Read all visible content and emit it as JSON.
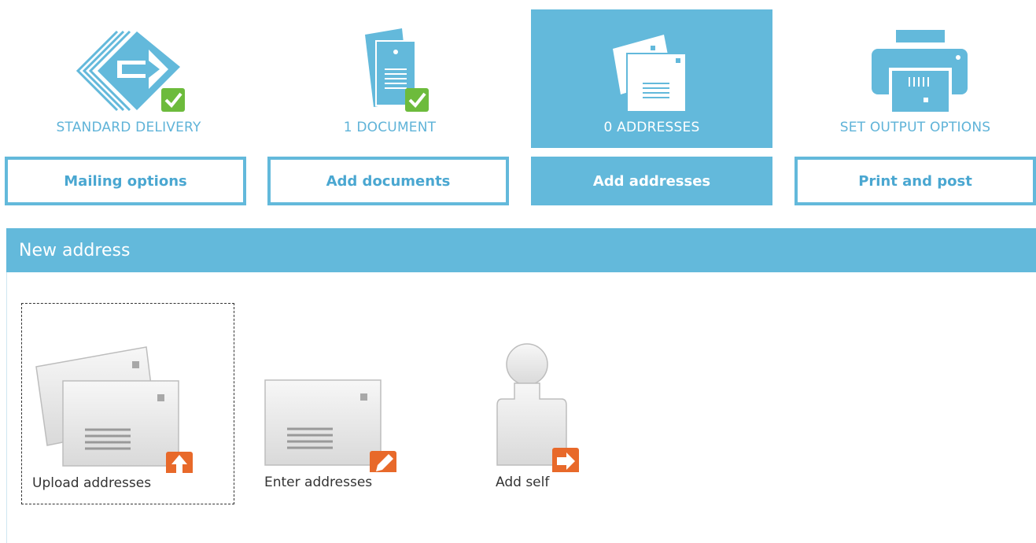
{
  "steps": [
    {
      "status": "STANDARD DELIVERY",
      "button_label": "Mailing options",
      "icon": "delivery-arrow-icon",
      "complete": true
    },
    {
      "status": "1 DOCUMENT",
      "button_label": "Add documents",
      "icon": "document-icon",
      "complete": true
    },
    {
      "status": "0 ADDRESSES",
      "button_label": "Add addresses",
      "icon": "envelopes-icon",
      "active": true
    },
    {
      "status": "SET OUTPUT OPTIONS",
      "button_label": "Print and post",
      "icon": "printer-icon"
    }
  ],
  "panel": {
    "title": "New address",
    "options": [
      {
        "label": "Upload addresses",
        "icon": "upload-envelopes-icon",
        "selected": true
      },
      {
        "label": "Enter addresses",
        "icon": "edit-envelope-icon"
      },
      {
        "label": "Add self",
        "icon": "person-arrow-icon"
      }
    ]
  },
  "colors": {
    "accent": "#63b9db",
    "check_green": "#6dbb3c",
    "action_orange": "#e8692a"
  }
}
